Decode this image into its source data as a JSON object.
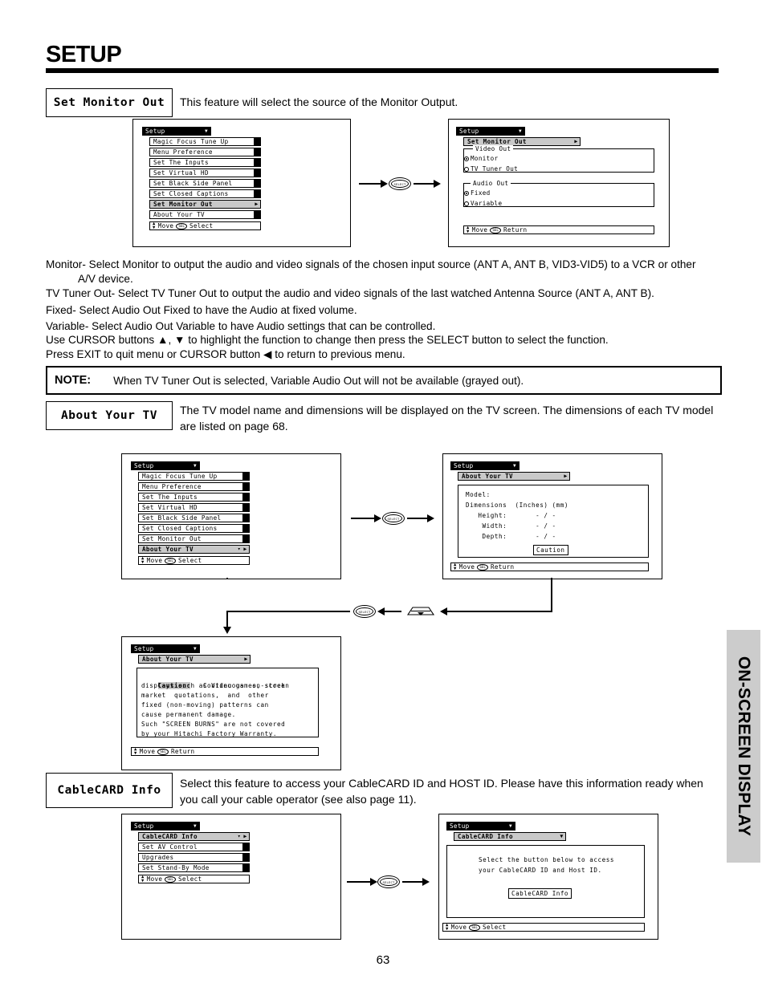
{
  "page": {
    "title": "SETUP",
    "number": "63",
    "side_tab": "ON-SCREEN DISPLAY"
  },
  "sections": [
    {
      "label": "Set Monitor Out",
      "description": "This feature will select the source of the Monitor Output."
    },
    {
      "label": "About Your TV",
      "description": "The TV model name and dimensions will be displayed on the TV screen.  The dimensions of each TV model are listed on page 68."
    },
    {
      "label": "CableCARD Info",
      "description": "Select this feature to access your CableCARD ID and HOST ID.  Please have this information ready when you call your cable operator (see also page 11)."
    }
  ],
  "paragraphs": [
    "Monitor- Select Monitor to output the audio and video signals of the chosen input source (ANT A, ANT B, VID3-VID5) to a VCR or other",
    "A/V device.",
    "TV Tuner Out- Select TV Tuner Out to output the audio and video signals of the last watched Antenna Source (ANT A, ANT B).",
    "Fixed-  Select Audio Out Fixed to have the Audio at fixed volume.",
    "Variable- Select Audio Out Variable to have Audio settings that can be controlled.",
    "Use CURSOR buttons ▲, ▼ to highlight the function to change then press the SELECT button to select the function.",
    "Press EXIT to quit menu or CURSOR button ◀ to return to previous menu."
  ],
  "note": {
    "label": "NOTE:",
    "text": "When TV Tuner Out is selected, Variable Audio Out will not be available (grayed out)."
  },
  "osd": {
    "menu_title": "Setup",
    "help_move": "Move",
    "help_select": "Select",
    "help_return": "Return",
    "select_key": "SEL",
    "select_button": "SELECT"
  },
  "diagram1": {
    "left_menu": {
      "title": "Setup",
      "items": [
        {
          "label": "Magic Focus Tune Up",
          "state": "normal"
        },
        {
          "label": "Menu Preference",
          "state": "normal"
        },
        {
          "label": "Set The Inputs",
          "state": "normal"
        },
        {
          "label": "Set Virtual HD",
          "state": "normal"
        },
        {
          "label": "Set Black Side Panel",
          "state": "normal"
        },
        {
          "label": "Set Closed Captions",
          "state": "normal"
        },
        {
          "label": "Set Monitor Out",
          "state": "selected"
        },
        {
          "label": "About Your TV",
          "state": "scroll"
        }
      ],
      "footer_move": "Move",
      "footer_action": "Select"
    },
    "right_menu": {
      "title": "Setup",
      "header": "Set Monitor Out",
      "groups": [
        {
          "legend": "Video Out",
          "options": [
            {
              "label": "Monitor",
              "checked": true
            },
            {
              "label": "TV Tuner Out",
              "checked": false
            }
          ]
        },
        {
          "legend": "Audio Out",
          "options": [
            {
              "label": "Fixed",
              "checked": true
            },
            {
              "label": "Variable",
              "checked": false
            }
          ]
        }
      ],
      "footer_move": "Move",
      "footer_action": "Return"
    }
  },
  "diagram2": {
    "left_menu": {
      "title": "Setup",
      "items": [
        {
          "label": "Magic Focus Tune Up",
          "state": "normal"
        },
        {
          "label": "Menu Preference",
          "state": "normal"
        },
        {
          "label": "Set The Inputs",
          "state": "normal"
        },
        {
          "label": "Set Virtual HD",
          "state": "normal"
        },
        {
          "label": "Set Black Side Panel",
          "state": "normal"
        },
        {
          "label": "Set Closed Captions",
          "state": "normal"
        },
        {
          "label": "Set Monitor Out",
          "state": "normal"
        },
        {
          "label": "About Your TV",
          "state": "selected-scroll"
        }
      ],
      "footer_move": "Move",
      "footer_action": "Select"
    },
    "right_menu": {
      "title": "Setup",
      "header": "About Your TV",
      "lines": [
        "Model:",
        "Dimensions  (Inches) (mm)",
        "   Height:       - / -",
        "    Width:       - / -",
        "    Depth:       - / -"
      ],
      "caution_button": "Caution",
      "footer_move": "Move",
      "footer_action": "Return"
    }
  },
  "diagram3": {
    "menu": {
      "title": "Setup",
      "header": "About Your TV",
      "caution_label": "Caution:",
      "lines": [
        "Caution:   Continuous  on-screen",
        "displays such as Video games, stock",
        "market  quotations,  and  other",
        "fixed (non-moving) patterns can",
        "cause permanent damage.",
        "Such \"SCREEN BURNS\" are not covered",
        "by your Hitachi Factory Warranty."
      ],
      "footer_move": "Move",
      "footer_action": "Return"
    }
  },
  "diagram4": {
    "left_menu": {
      "title": "Setup",
      "items": [
        {
          "label": "CableCARD Info",
          "state": "selected-scroll"
        },
        {
          "label": "Set AV Control",
          "state": "normal"
        },
        {
          "label": "Upgrades",
          "state": "normal"
        },
        {
          "label": "Set Stand-By Mode",
          "state": "normal"
        }
      ],
      "footer_move": "Move",
      "footer_action": "Select"
    },
    "right_menu": {
      "title": "Setup",
      "header": "CableCARD Info",
      "lines": [
        "Select the button below to access",
        "your CableCARD ID and Host ID."
      ],
      "action_button": "CableCARD Info",
      "footer_move": "Move",
      "footer_action": "Select"
    }
  }
}
